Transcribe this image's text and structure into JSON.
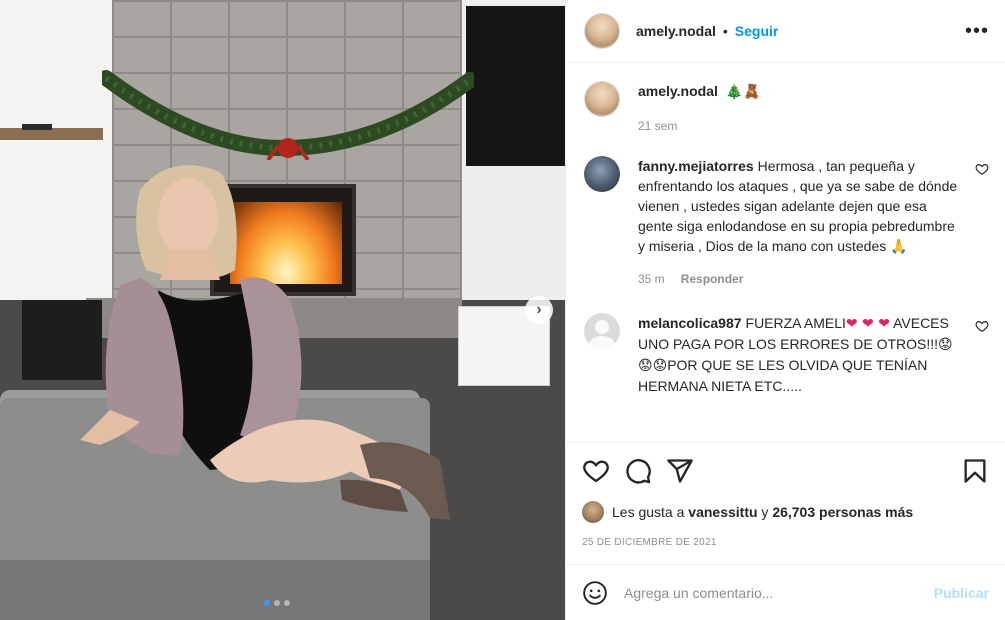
{
  "post": {
    "username": "amely.nodal",
    "follow_label": "Seguir",
    "separator": "•",
    "more_glyph": "•••",
    "caption_emoji": "🎄🧸",
    "caption_time": "21 sem"
  },
  "media": {
    "next_glyph": "›",
    "slides_count": 3,
    "active_slide": 1
  },
  "comments": [
    {
      "username": "fanny.mejiatorres",
      "text": "Hermosa , tan pequeña y enfrentando los ataques , que ya se sabe de dónde vienen , ustedes sigan adelante dejen que esa gente siga enlodandose en su propia pebredumbre y miseria , Dios de la mano con ustedes",
      "emoji": "🙏",
      "time": "35 m",
      "reply_label": "Responder"
    },
    {
      "username": "melancolica987",
      "text_a": "FUERZA AMELI",
      "hearts": "❤ ❤ ❤",
      "text_b": "AVECES UNO PAGA POR LOS ERRORES DE OTROS!!!",
      "sad": "😟😟😟",
      "text_c": "POR QUE SE LES OLVIDA QUE TENÍAN HERMANA NIETA ETC....."
    }
  ],
  "likes": {
    "prefix": "Les gusta a",
    "liker": "vanessittu",
    "middle": "y",
    "count_text": "26,703 personas más"
  },
  "date": "25 de diciembre de 2021",
  "composer": {
    "placeholder": "Agrega un comentario...",
    "publish_label": "Publicar"
  },
  "colors": {
    "link_blue": "#0095f6",
    "publish_disabled": "#b2dffc",
    "muted": "#8e8e8e",
    "text": "#262626"
  }
}
